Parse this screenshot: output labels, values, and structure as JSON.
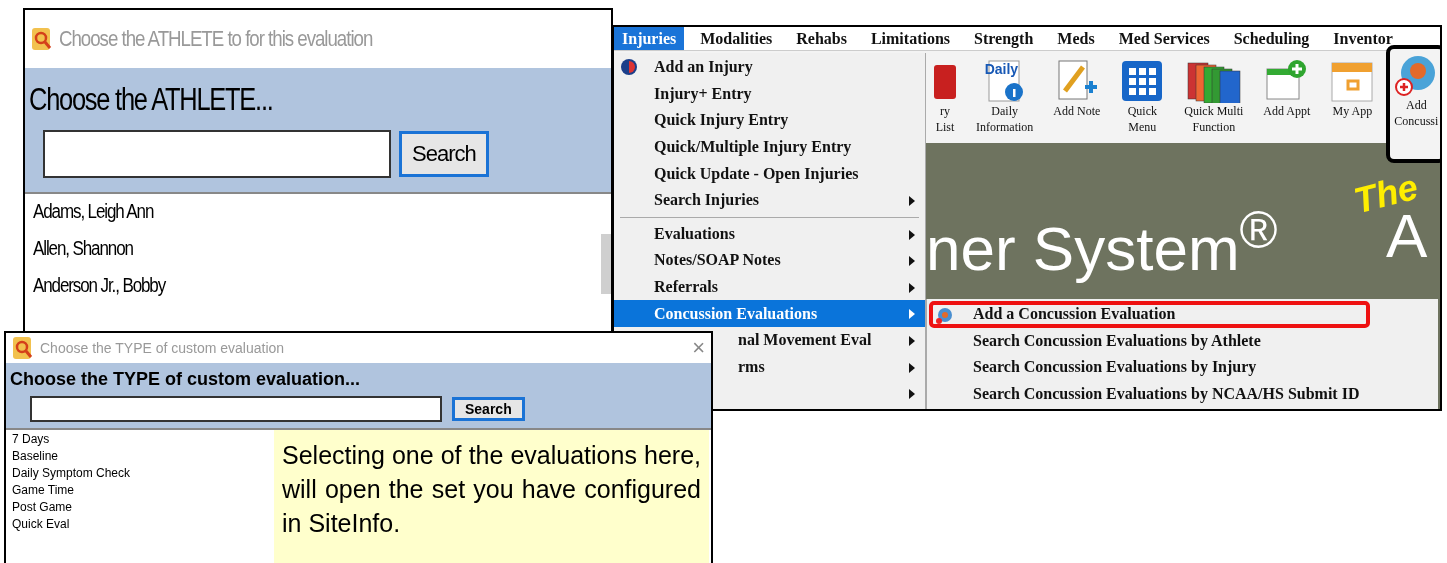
{
  "athlete_window": {
    "title": "Choose the ATHLETE to for this evaluation",
    "heading": "Choose the ATHLETE...",
    "search_button": "Search",
    "athletes": [
      "Adams, Leigh Ann",
      "Allen, Shannon",
      "Anderson Jr., Bobby"
    ]
  },
  "app_window": {
    "menu_bar": [
      {
        "label": "Injuries",
        "selected": true
      },
      {
        "label": "Modalities",
        "selected": false
      },
      {
        "label": "Rehabs",
        "selected": false
      },
      {
        "label": "Limitations",
        "selected": false
      },
      {
        "label": "Strength",
        "selected": false
      },
      {
        "label": "Meds",
        "selected": false
      },
      {
        "label": "Med Services",
        "selected": false
      },
      {
        "label": "Scheduling",
        "selected": false
      },
      {
        "label": "Inventor",
        "selected": false
      }
    ],
    "toolbar": [
      {
        "kind": "folder",
        "lines": [
          "ry",
          "List"
        ],
        "outlined": false
      },
      {
        "kind": "daily",
        "badge": "Daily",
        "lines": [
          "Daily",
          "Information"
        ],
        "outlined": false
      },
      {
        "kind": "note",
        "lines": [
          "Add Note"
        ],
        "outlined": false
      },
      {
        "kind": "grid",
        "lines": [
          "Quick",
          "Menu"
        ],
        "outlined": false
      },
      {
        "kind": "folders",
        "lines": [
          "Quick Multi",
          "Function"
        ],
        "outlined": false
      },
      {
        "kind": "appt",
        "lines": [
          "Add Appt"
        ],
        "outlined": false
      },
      {
        "kind": "calendar",
        "lines": [
          "My App"
        ],
        "outlined": false
      },
      {
        "kind": "brain",
        "lines": [
          "Add",
          "Concussi"
        ],
        "outlined": true
      }
    ],
    "banner": {
      "tag": "The",
      "title": "ner System$^{®}$",
      "letter": "A"
    },
    "dropdown": [
      {
        "kind": "item",
        "label": "Add an Injury",
        "icon": true,
        "submenu": false,
        "selected": false
      },
      {
        "kind": "item",
        "label": "Injury+ Entry",
        "icon": false,
        "submenu": false,
        "selected": false
      },
      {
        "kind": "item",
        "label": "Quick Injury Entry",
        "icon": false,
        "submenu": false,
        "selected": false
      },
      {
        "kind": "item",
        "label": "Quick/Multiple Injury Entry",
        "icon": false,
        "submenu": false,
        "selected": false
      },
      {
        "kind": "item",
        "label": "Quick Update - Open Injuries",
        "icon": false,
        "submenu": false,
        "selected": false
      },
      {
        "kind": "item",
        "label": "Search Injuries",
        "icon": false,
        "submenu": true,
        "selected": false
      },
      {
        "kind": "separator"
      },
      {
        "kind": "item",
        "label": "Evaluations",
        "icon": false,
        "submenu": true,
        "selected": false
      },
      {
        "kind": "item",
        "label": "Notes/SOAP Notes",
        "icon": false,
        "submenu": true,
        "selected": false
      },
      {
        "kind": "item",
        "label": "Referrals",
        "icon": false,
        "submenu": true,
        "selected": false
      },
      {
        "kind": "item",
        "label": "Concussion Evaluations",
        "icon": false,
        "submenu": true,
        "selected": true
      },
      {
        "kind": "covered",
        "label": "nal Movement Eval",
        "submenu": true,
        "selected": false
      },
      {
        "kind": "covered",
        "label": "rms",
        "submenu": true,
        "selected": false
      },
      {
        "kind": "covered",
        "submenu": true,
        "selected": false
      }
    ],
    "submenu": [
      {
        "label": "Add a Concussion Evaluation",
        "icon": true,
        "outlined": true
      },
      {
        "label": "Search Concussion Evaluations by Athlete",
        "icon": false,
        "outlined": false
      },
      {
        "label": "Search Concussion Evaluations by Injury",
        "icon": false,
        "outlined": false
      },
      {
        "label": "Search Concussion Evaluations by NCAA/HS Submit ID",
        "icon": false,
        "outlined": false
      }
    ]
  },
  "type_window": {
    "title": "Choose the TYPE of custom evaluation",
    "close": "×",
    "heading": "Choose the TYPE of custom evaluation...",
    "search_button": "Search",
    "types": [
      "7 Days",
      "Baseline",
      "Daily Symptom Check",
      "Game Time",
      "Post Game",
      "Quick Eval"
    ],
    "callout": "Selecting one of the evaluations here, will open the set you have configured in SiteInfo."
  }
}
